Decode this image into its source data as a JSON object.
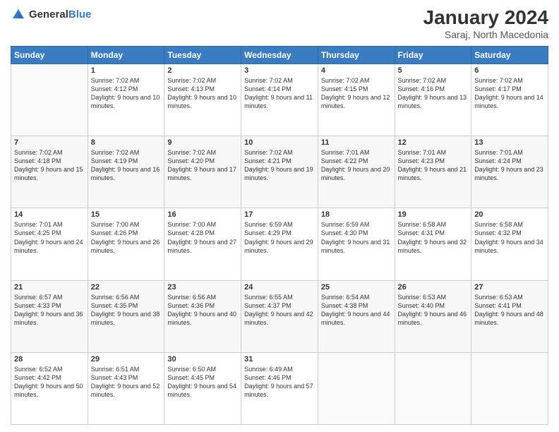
{
  "header": {
    "logo_general": "General",
    "logo_blue": "Blue",
    "title": "January 2024",
    "subtitle": "Saraj, North Macedonia"
  },
  "days_of_week": [
    "Sunday",
    "Monday",
    "Tuesday",
    "Wednesday",
    "Thursday",
    "Friday",
    "Saturday"
  ],
  "weeks": [
    {
      "days": [
        {
          "num": "",
          "sunrise": "",
          "sunset": "",
          "daylight": "",
          "empty": true
        },
        {
          "num": "1",
          "sunrise": "Sunrise: 7:02 AM",
          "sunset": "Sunset: 4:12 PM",
          "daylight": "Daylight: 9 hours and 10 minutes."
        },
        {
          "num": "2",
          "sunrise": "Sunrise: 7:02 AM",
          "sunset": "Sunset: 4:13 PM",
          "daylight": "Daylight: 9 hours and 10 minutes."
        },
        {
          "num": "3",
          "sunrise": "Sunrise: 7:02 AM",
          "sunset": "Sunset: 4:14 PM",
          "daylight": "Daylight: 9 hours and 11 minutes."
        },
        {
          "num": "4",
          "sunrise": "Sunrise: 7:02 AM",
          "sunset": "Sunset: 4:15 PM",
          "daylight": "Daylight: 9 hours and 12 minutes."
        },
        {
          "num": "5",
          "sunrise": "Sunrise: 7:02 AM",
          "sunset": "Sunset: 4:16 PM",
          "daylight": "Daylight: 9 hours and 13 minutes."
        },
        {
          "num": "6",
          "sunrise": "Sunrise: 7:02 AM",
          "sunset": "Sunset: 4:17 PM",
          "daylight": "Daylight: 9 hours and 14 minutes."
        }
      ]
    },
    {
      "days": [
        {
          "num": "7",
          "sunrise": "Sunrise: 7:02 AM",
          "sunset": "Sunset: 4:18 PM",
          "daylight": "Daylight: 9 hours and 15 minutes."
        },
        {
          "num": "8",
          "sunrise": "Sunrise: 7:02 AM",
          "sunset": "Sunset: 4:19 PM",
          "daylight": "Daylight: 9 hours and 16 minutes."
        },
        {
          "num": "9",
          "sunrise": "Sunrise: 7:02 AM",
          "sunset": "Sunset: 4:20 PM",
          "daylight": "Daylight: 9 hours and 17 minutes."
        },
        {
          "num": "10",
          "sunrise": "Sunrise: 7:02 AM",
          "sunset": "Sunset: 4:21 PM",
          "daylight": "Daylight: 9 hours and 19 minutes."
        },
        {
          "num": "11",
          "sunrise": "Sunrise: 7:01 AM",
          "sunset": "Sunset: 4:22 PM",
          "daylight": "Daylight: 9 hours and 20 minutes."
        },
        {
          "num": "12",
          "sunrise": "Sunrise: 7:01 AM",
          "sunset": "Sunset: 4:23 PM",
          "daylight": "Daylight: 9 hours and 21 minutes."
        },
        {
          "num": "13",
          "sunrise": "Sunrise: 7:01 AM",
          "sunset": "Sunset: 4:24 PM",
          "daylight": "Daylight: 9 hours and 23 minutes."
        }
      ]
    },
    {
      "days": [
        {
          "num": "14",
          "sunrise": "Sunrise: 7:01 AM",
          "sunset": "Sunset: 4:25 PM",
          "daylight": "Daylight: 9 hours and 24 minutes."
        },
        {
          "num": "15",
          "sunrise": "Sunrise: 7:00 AM",
          "sunset": "Sunset: 4:26 PM",
          "daylight": "Daylight: 9 hours and 26 minutes."
        },
        {
          "num": "16",
          "sunrise": "Sunrise: 7:00 AM",
          "sunset": "Sunset: 4:28 PM",
          "daylight": "Daylight: 9 hours and 27 minutes."
        },
        {
          "num": "17",
          "sunrise": "Sunrise: 6:59 AM",
          "sunset": "Sunset: 4:29 PM",
          "daylight": "Daylight: 9 hours and 29 minutes."
        },
        {
          "num": "18",
          "sunrise": "Sunrise: 6:59 AM",
          "sunset": "Sunset: 4:30 PM",
          "daylight": "Daylight: 9 hours and 31 minutes."
        },
        {
          "num": "19",
          "sunrise": "Sunrise: 6:58 AM",
          "sunset": "Sunset: 4:31 PM",
          "daylight": "Daylight: 9 hours and 32 minutes."
        },
        {
          "num": "20",
          "sunrise": "Sunrise: 6:58 AM",
          "sunset": "Sunset: 4:32 PM",
          "daylight": "Daylight: 9 hours and 34 minutes."
        }
      ]
    },
    {
      "days": [
        {
          "num": "21",
          "sunrise": "Sunrise: 6:57 AM",
          "sunset": "Sunset: 4:33 PM",
          "daylight": "Daylight: 9 hours and 36 minutes."
        },
        {
          "num": "22",
          "sunrise": "Sunrise: 6:56 AM",
          "sunset": "Sunset: 4:35 PM",
          "daylight": "Daylight: 9 hours and 38 minutes."
        },
        {
          "num": "23",
          "sunrise": "Sunrise: 6:56 AM",
          "sunset": "Sunset: 4:36 PM",
          "daylight": "Daylight: 9 hours and 40 minutes."
        },
        {
          "num": "24",
          "sunrise": "Sunrise: 6:55 AM",
          "sunset": "Sunset: 4:37 PM",
          "daylight": "Daylight: 9 hours and 42 minutes."
        },
        {
          "num": "25",
          "sunrise": "Sunrise: 6:54 AM",
          "sunset": "Sunset: 4:38 PM",
          "daylight": "Daylight: 9 hours and 44 minutes."
        },
        {
          "num": "26",
          "sunrise": "Sunrise: 6:53 AM",
          "sunset": "Sunset: 4:40 PM",
          "daylight": "Daylight: 9 hours and 46 minutes."
        },
        {
          "num": "27",
          "sunrise": "Sunrise: 6:53 AM",
          "sunset": "Sunset: 4:41 PM",
          "daylight": "Daylight: 9 hours and 48 minutes."
        }
      ]
    },
    {
      "days": [
        {
          "num": "28",
          "sunrise": "Sunrise: 6:52 AM",
          "sunset": "Sunset: 4:42 PM",
          "daylight": "Daylight: 9 hours and 50 minutes."
        },
        {
          "num": "29",
          "sunrise": "Sunrise: 6:51 AM",
          "sunset": "Sunset: 4:43 PM",
          "daylight": "Daylight: 9 hours and 52 minutes."
        },
        {
          "num": "30",
          "sunrise": "Sunrise: 6:50 AM",
          "sunset": "Sunset: 4:45 PM",
          "daylight": "Daylight: 9 hours and 54 minutes."
        },
        {
          "num": "31",
          "sunrise": "Sunrise: 6:49 AM",
          "sunset": "Sunset: 4:46 PM",
          "daylight": "Daylight: 9 hours and 57 minutes."
        },
        {
          "num": "",
          "sunrise": "",
          "sunset": "",
          "daylight": "",
          "empty": true
        },
        {
          "num": "",
          "sunrise": "",
          "sunset": "",
          "daylight": "",
          "empty": true
        },
        {
          "num": "",
          "sunrise": "",
          "sunset": "",
          "daylight": "",
          "empty": true
        }
      ]
    }
  ]
}
